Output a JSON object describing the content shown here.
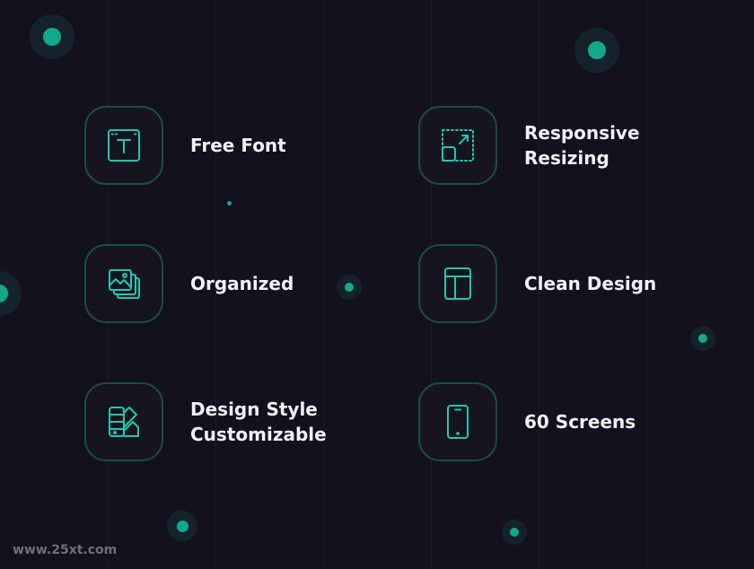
{
  "features": [
    {
      "label": "Free Font",
      "icon": "text-frame-icon"
    },
    {
      "label": "Responsive\nResizing",
      "icon": "resize-icon"
    },
    {
      "label": "Organized",
      "icon": "stacked-images-icon"
    },
    {
      "label": "Clean  Design",
      "icon": "layout-icon"
    },
    {
      "label": "Design Style\nCustomizable",
      "icon": "design-tools-icon"
    },
    {
      "label": "60 Screens",
      "icon": "phone-icon"
    }
  ],
  "watermark": "www.25xt.com",
  "colors": {
    "background": "#13111e",
    "accent": "#20c9b0",
    "border": "#1f4a45",
    "text": "#f1f1f4"
  }
}
